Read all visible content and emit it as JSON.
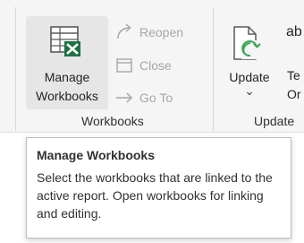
{
  "ribbon": {
    "workbooks_group": {
      "manage_workbooks": {
        "line1": "Manage",
        "line2": "Workbooks",
        "icon": "excel-table-icon"
      },
      "reopen": {
        "label": "Reopen",
        "icon": "reopen-arrow-icon"
      },
      "close": {
        "label": "Close",
        "icon": "close-window-icon"
      },
      "go_to": {
        "label": "Go To",
        "icon": "go-to-arrow-icon"
      },
      "label": "Workbooks"
    },
    "update_group": {
      "update": {
        "label": "Update",
        "dropdown_glyph": "⌄",
        "icon": "update-document-icon"
      },
      "partial_top": "ab",
      "partial_mid1": "Te",
      "partial_mid2": "Or",
      "label": "Update"
    }
  },
  "tooltip": {
    "title": "Manage Workbooks",
    "body": "Select the workbooks that are linked to the active report. Open workbooks for linking and editing."
  },
  "colors": {
    "excel_green": "#1e7145",
    "update_green": "#3aa655",
    "disabled_text": "#a6a6a6",
    "hover_bg": "#e6e6e6"
  }
}
